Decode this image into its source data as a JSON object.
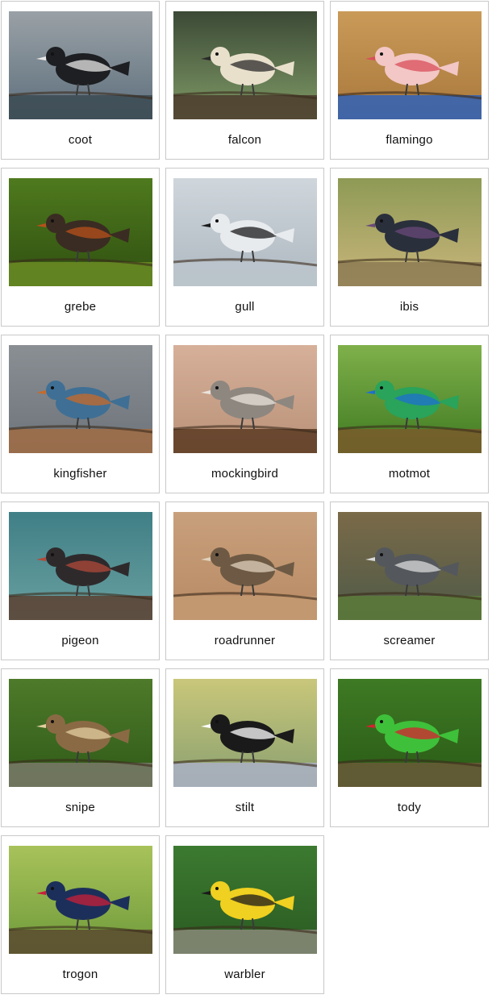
{
  "cards": [
    {
      "label": "coot",
      "palette": {
        "bg1": "#9aa1a6",
        "bg2": "#5d6f7d",
        "body": "#1d1f22",
        "accent": "#e8e8e8",
        "ground": "#3b4a52"
      }
    },
    {
      "label": "falcon",
      "palette": {
        "bg1": "#3c4a36",
        "bg2": "#7f9a66",
        "body": "#e9e0cc",
        "accent": "#2a2a2a",
        "ground": "#4b3b2c"
      }
    },
    {
      "label": "flamingo",
      "palette": {
        "bg1": "#c99a58",
        "bg2": "#a9783c",
        "body": "#f2c7c5",
        "accent": "#d94e5a",
        "ground": "#2f62b8"
      }
    },
    {
      "label": "grebe",
      "palette": {
        "bg1": "#4f7a1e",
        "bg2": "#2f4f10",
        "body": "#3a2c22",
        "accent": "#b8501b",
        "ground": "#6b8c25"
      }
    },
    {
      "label": "gull",
      "palette": {
        "bg1": "#cfd6dc",
        "bg2": "#aeb8c0",
        "body": "#e8ebee",
        "accent": "#1b1b1b",
        "ground": "#bcc5cc"
      }
    },
    {
      "label": "ibis",
      "palette": {
        "bg1": "#8e9a55",
        "bg2": "#c9b57b",
        "body": "#2a2f3c",
        "accent": "#6a4a7a",
        "ground": "#8c7a54"
      }
    },
    {
      "label": "kingfisher",
      "palette": {
        "bg1": "#8a8f94",
        "bg2": "#6d737a",
        "body": "#3f6f95",
        "accent": "#c86a2a",
        "ground": "#a06c44"
      }
    },
    {
      "label": "mockingbird",
      "palette": {
        "bg1": "#d7b09a",
        "bg2": "#b99178",
        "body": "#8e8780",
        "accent": "#e9e3dc",
        "ground": "#5a3a22"
      }
    },
    {
      "label": "motmot",
      "palette": {
        "bg1": "#7fb04a",
        "bg2": "#3f7a22",
        "body": "#2aa35b",
        "accent": "#1e6fd0",
        "ground": "#7a5a2c"
      }
    },
    {
      "label": "pigeon",
      "palette": {
        "bg1": "#3f7f86",
        "bg2": "#6aa0a0",
        "body": "#2e2a2c",
        "accent": "#b04a3a",
        "ground": "#5a4030"
      }
    },
    {
      "label": "roadrunner",
      "palette": {
        "bg1": "#c8a07c",
        "bg2": "#b88a64",
        "body": "#6e5a44",
        "accent": "#e0d2bc",
        "ground": "#c39a72"
      }
    },
    {
      "label": "screamer",
      "palette": {
        "bg1": "#7a6a48",
        "bg2": "#4f5a48",
        "body": "#54585c",
        "accent": "#d9d9d9",
        "ground": "#5c7a3a"
      }
    },
    {
      "label": "snipe",
      "palette": {
        "bg1": "#4e7a2a",
        "bg2": "#2f5a18",
        "body": "#8a6a44",
        "accent": "#e2cfa0",
        "ground": "#7a7a6a"
      }
    },
    {
      "label": "stilt",
      "palette": {
        "bg1": "#c9c77a",
        "bg2": "#8aa070",
        "body": "#1a1a1a",
        "accent": "#ffffff",
        "ground": "#aab0c4"
      }
    },
    {
      "label": "tody",
      "palette": {
        "bg1": "#3e7a24",
        "bg2": "#2a5a16",
        "body": "#3fc03a",
        "accent": "#d82030",
        "ground": "#6a5a3a"
      }
    },
    {
      "label": "trogon",
      "palette": {
        "bg1": "#a8c25a",
        "bg2": "#6e9a3a",
        "body": "#1c2f5a",
        "accent": "#c8203a",
        "ground": "#5a4a30"
      }
    },
    {
      "label": "warbler",
      "palette": {
        "bg1": "#3c7a30",
        "bg2": "#2a5a22",
        "body": "#f0d020",
        "accent": "#1a1a1a",
        "ground": "#8a8a7a"
      }
    }
  ]
}
